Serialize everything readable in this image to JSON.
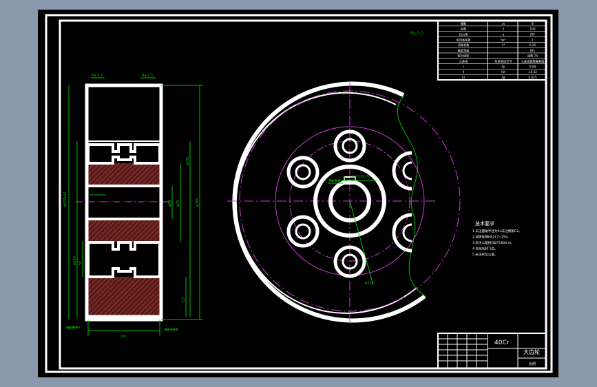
{
  "drawing": {
    "material": "40Cr",
    "title": "大齿轮",
    "title_sub": "比例",
    "tolerance_label": "Ra 3.2",
    "tech_req": {
      "heading": "技术要求",
      "items": [
        "1.未注圆角半径为R3未注倒角C2。",
        "2.调质处理HB217~255。",
        "3.未注公差按GB/T1804-m。",
        "4.去除毛刺飞边。",
        "5.未注形位公差。"
      ]
    },
    "param_table": {
      "rows": [
        [
          "模数",
          "m",
          "8"
        ],
        [
          "齿数",
          "z",
          "100"
        ],
        [
          "压力角",
          "α",
          "20°"
        ],
        [
          "齿顶高系数",
          "ha*",
          "1"
        ],
        [
          "顶隙系数",
          "c*",
          "0.25"
        ],
        [
          "精度等级",
          "",
          "8FL"
        ],
        [
          "配对齿轮",
          "",
          "齿数 24"
        ],
        [
          "公差组",
          "检验项目代号",
          "公差或极限偏差值"
        ],
        [
          "I",
          "Fp",
          "0.09"
        ],
        [
          "II",
          "fpt",
          "±0.02"
        ],
        [
          "III",
          "Fβ",
          "0.025"
        ]
      ]
    },
    "section_dims": {
      "top_left": "Ra 3.2",
      "top_right": "Ra 6.3",
      "left_overall": "φ820h11",
      "mid_left": "φ640",
      "right_1": "φ380",
      "right_2": "φ186",
      "right_3": "φ55",
      "right_4": "φ83",
      "bottom_width": "160",
      "bottom_left": "Ra 6.3",
      "bottom_right": "Ra 12.5",
      "low_left": "55",
      "low_right": "125"
    },
    "front_dims": {
      "keyway": "16±0.0215",
      "keyway_left": "Ra 3.2",
      "hole_circle": "φ120"
    }
  }
}
